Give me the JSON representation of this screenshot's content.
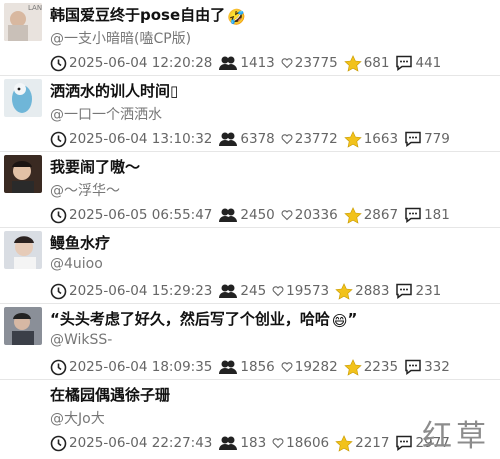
{
  "posts": [
    {
      "title": "韩国爱豆终于pose自由了",
      "title_emoji": "🤣",
      "author": "@一支小暗暗(嗑CP版)",
      "time": "2025-06-04 12:20:28",
      "views": "1413",
      "likes": "23775",
      "stars": "681",
      "comments": "441",
      "thumb_label": "LAN"
    },
    {
      "title": "洒洒水的训人时间",
      "title_emoji": "▯",
      "author": "@一口一个洒洒水",
      "time": "2025-06-04 13:10:32",
      "views": "6378",
      "likes": "23772",
      "stars": "1663",
      "comments": "779"
    },
    {
      "title": "我要闹了嗷～",
      "author": "@～浮华～",
      "time": "2025-06-05 06:55:47",
      "views": "2450",
      "likes": "20336",
      "stars": "2867",
      "comments": "181"
    },
    {
      "title": "鳗鱼水疗",
      "author": "@4uioo",
      "time": "2025-06-04 15:29:23",
      "views": "245",
      "likes": "19573",
      "stars": "2883",
      "comments": "231"
    },
    {
      "title": "“头头考虑了好久，然后写了个创业，哈哈",
      "title_emoji": "😄",
      "title_tail": "”",
      "author": "@WikSS-",
      "time": "2025-06-04 18:09:35",
      "views": "1856",
      "likes": "19282",
      "stars": "2235",
      "comments": "332"
    },
    {
      "title": "在橘园偶遇徐子珊",
      "author": "@大Jo大",
      "time": "2025-06-04 22:27:43",
      "views": "183",
      "likes": "18606",
      "stars": "2217",
      "comments": "2977"
    }
  ],
  "watermark": "红草",
  "colors": {
    "star": "#f2c21b",
    "text": "#111111",
    "muted": "#777777"
  },
  "icons": {
    "time": "clock-icon",
    "views": "people-icon",
    "likes": "heart-icon",
    "stars": "star-icon",
    "comments": "comment-icon"
  }
}
